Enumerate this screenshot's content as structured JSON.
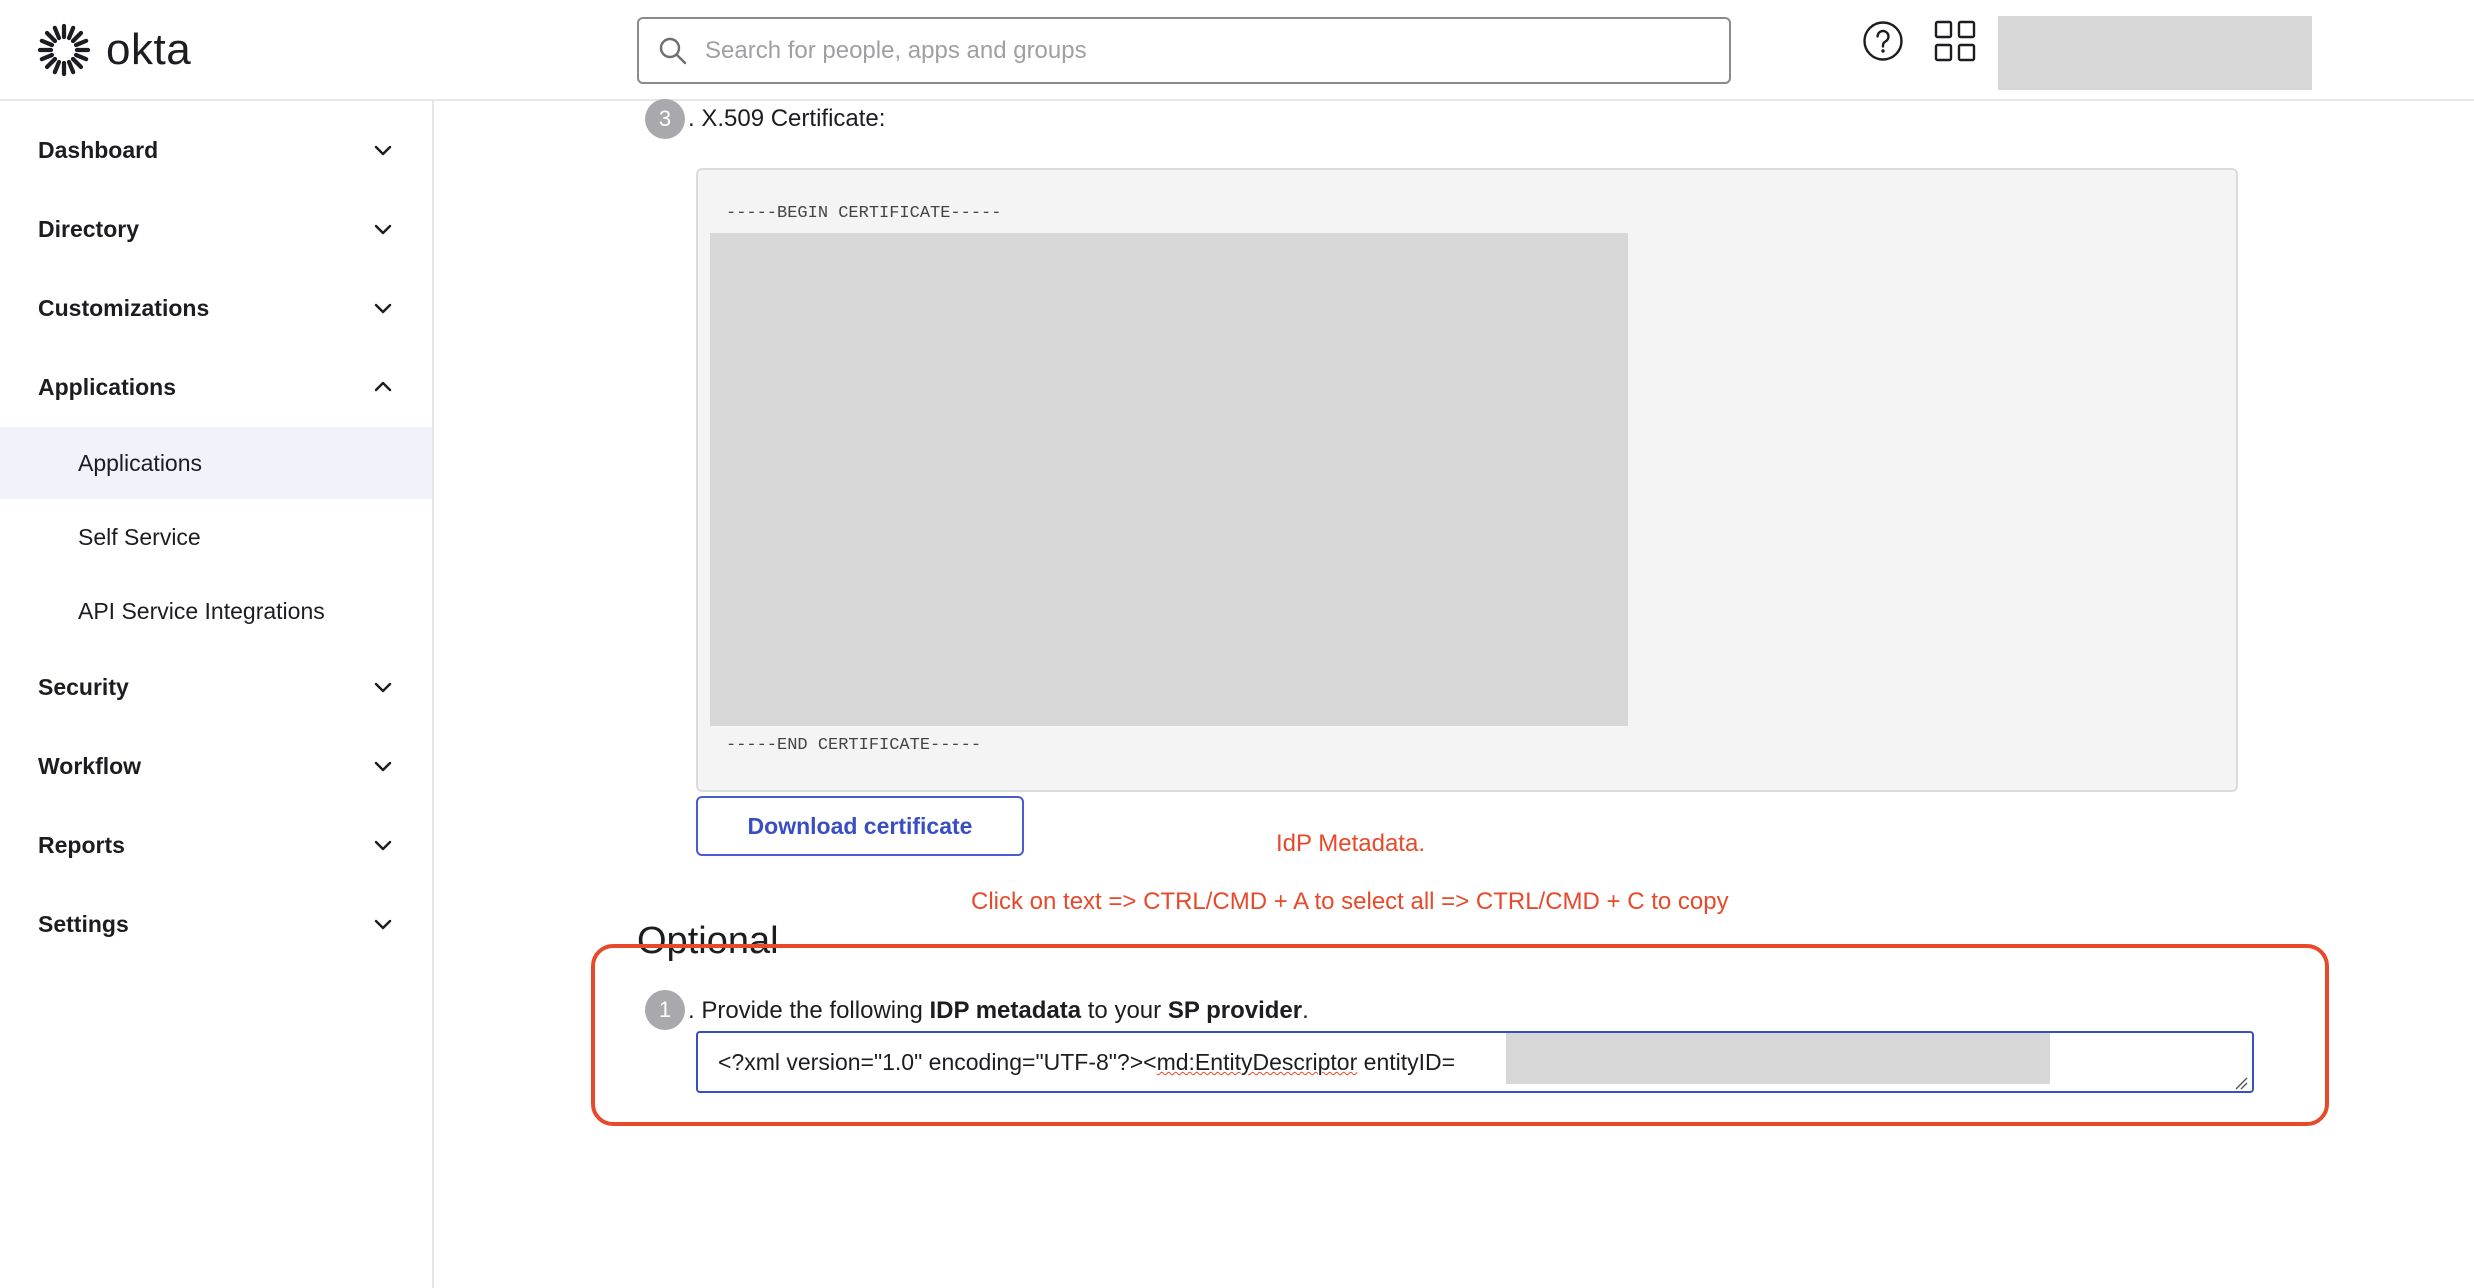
{
  "header": {
    "brand": "okta",
    "search_placeholder": "Search for people, apps and groups",
    "icons": [
      "okta-logo-icon",
      "search-icon",
      "help-icon",
      "app-grid-icon"
    ]
  },
  "sidebar": {
    "items": [
      {
        "label": "Dashboard",
        "expanded": false
      },
      {
        "label": "Directory",
        "expanded": false
      },
      {
        "label": "Customizations",
        "expanded": false
      },
      {
        "label": "Applications",
        "expanded": true
      },
      {
        "label": "Security",
        "expanded": false
      },
      {
        "label": "Workflow",
        "expanded": false
      },
      {
        "label": "Reports",
        "expanded": false
      },
      {
        "label": "Settings",
        "expanded": false
      }
    ],
    "sub_items": [
      {
        "label": "Applications",
        "active": true
      },
      {
        "label": "Self Service",
        "active": false
      },
      {
        "label": "API Service Integrations",
        "active": false
      }
    ]
  },
  "main": {
    "cert_step": {
      "number": "3",
      "label": ". X.509 Certificate:"
    },
    "cert_begin": "-----BEGIN CERTIFICATE-----",
    "cert_end": "-----END CERTIFICATE-----",
    "download_label": "Download certificate",
    "annotation_title": "IdP Metadata.",
    "annotation_hint": "Click on text => CTRL/CMD + A to select all => CTRL/CMD + C to copy",
    "optional_heading": "Optional",
    "idp_step": {
      "number": "1",
      "prefix": ". Provide the following ",
      "bold1": "IDP metadata",
      "middle": " to your ",
      "bold2": "SP provider",
      "suffix": "."
    },
    "metadata": {
      "part1": "<?xml version=\"1.0\" encoding=\"UTF-8\"?><",
      "part2": "md:EntityDescriptor",
      "part3": " entityID="
    }
  },
  "colors": {
    "accent": "#3a4ec4",
    "annotation": "#e8492a",
    "active_bg": "#f1f3fb",
    "redaction": "#d7d7d7"
  }
}
